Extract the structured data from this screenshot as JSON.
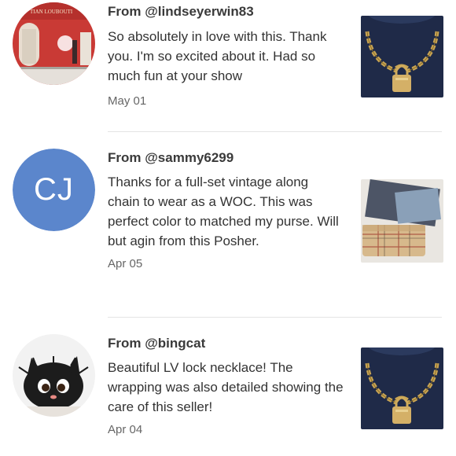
{
  "reviews": [
    {
      "from": "From @lindseyerwin83",
      "comment": "So absolutely in love with this. Thank you. I'm so excited about it. Had so much fun at your show",
      "date": "May 01",
      "avatar_store_text": "TIAN LOUBOUTI",
      "product_icon": "lock-necklace"
    },
    {
      "from": "From @sammy6299",
      "comment": "Thanks for a full-set vintage along chain to wear as a WOC. This was perfect color to matched my purse. Will but agin from this Posher.",
      "date": "Apr 05",
      "avatar_initials": "CJ",
      "avatar_color": "#5b86cc",
      "product_icon": "plaid-wallet-box"
    },
    {
      "from": "From @bingcat",
      "comment": "Beautiful LV lock necklace! The wrapping was also detailed showing the care of this seller!",
      "date": "Apr 04",
      "product_icon": "lock-necklace"
    }
  ],
  "colors": {
    "divider": "#e4e4e4",
    "date_text": "#666666",
    "username_text": "#3a3a3a"
  }
}
